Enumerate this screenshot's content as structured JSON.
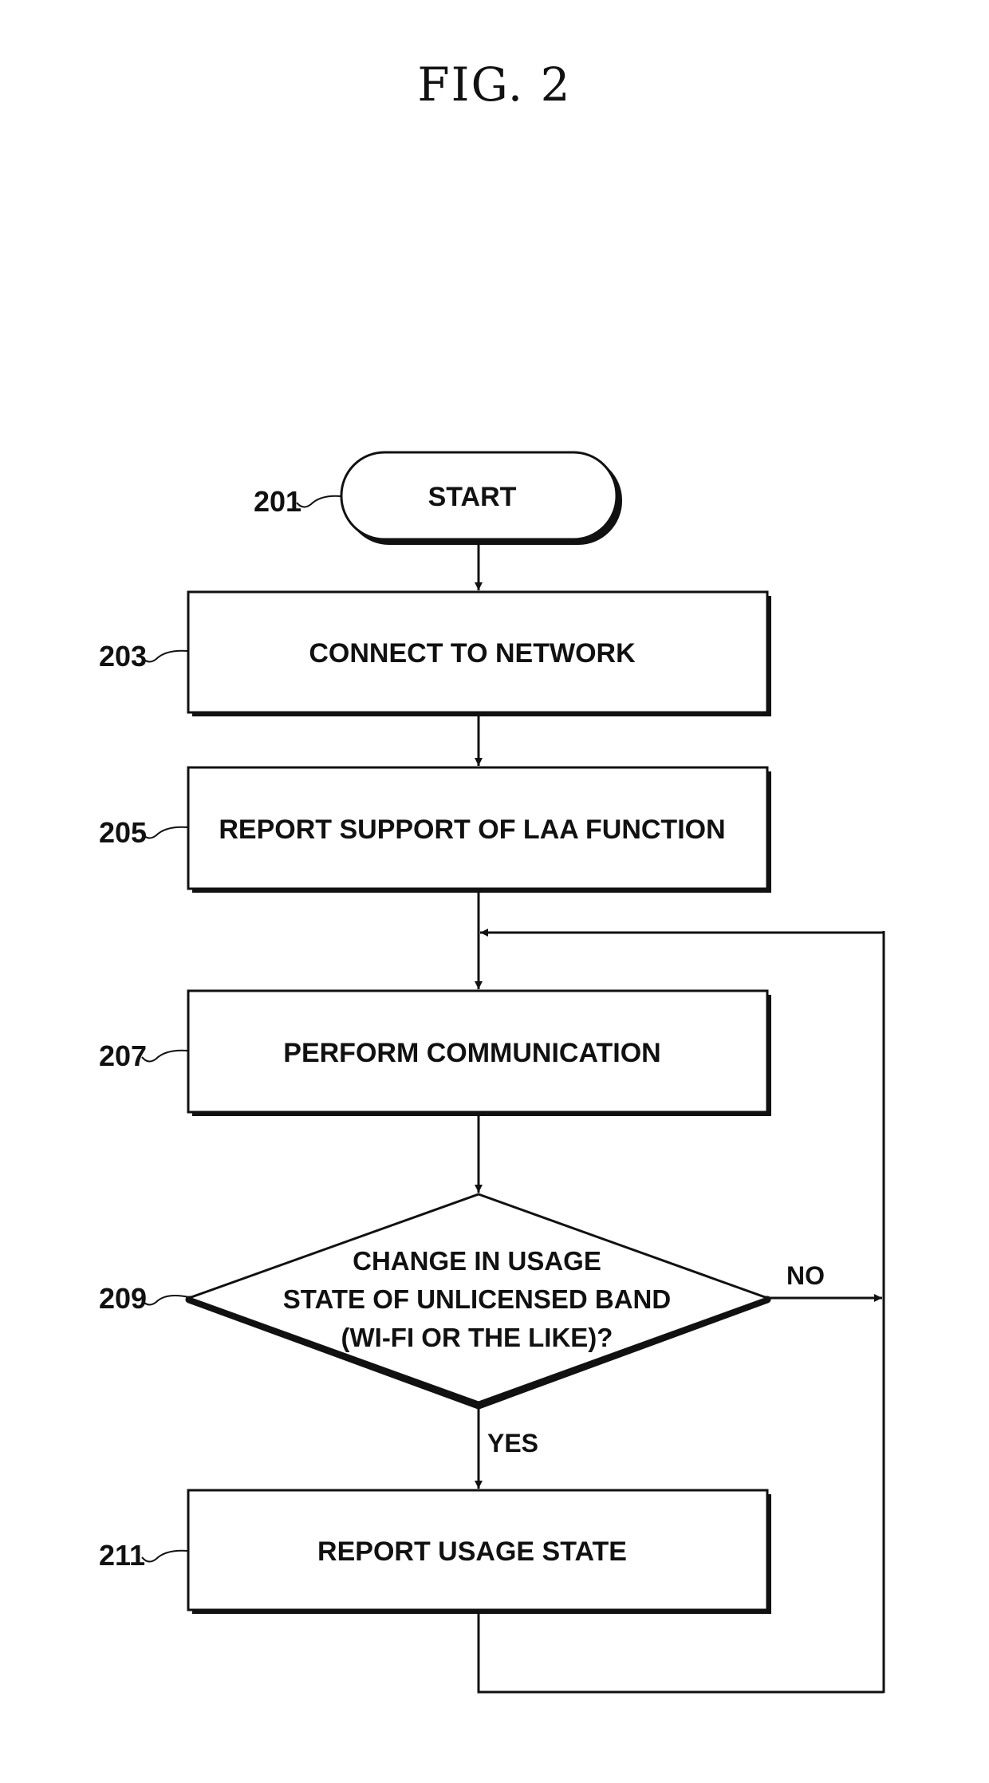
{
  "figure": {
    "title": "FIG. 2"
  },
  "nodes": [
    {
      "id": "201",
      "ref": "201",
      "type": "terminal",
      "lines": [
        "START"
      ]
    },
    {
      "id": "203",
      "ref": "203",
      "type": "process",
      "lines": [
        "CONNECT TO NETWORK"
      ]
    },
    {
      "id": "205",
      "ref": "205",
      "type": "process",
      "lines": [
        "REPORT SUPPORT OF LAA FUNCTION"
      ]
    },
    {
      "id": "207",
      "ref": "207",
      "type": "process",
      "lines": [
        "PERFORM COMMUNICATION"
      ]
    },
    {
      "id": "209",
      "ref": "209",
      "type": "decision",
      "lines": [
        "CHANGE IN USAGE",
        "STATE OF UNLICENSED BAND",
        "(WI-FI OR THE LIKE)?"
      ]
    },
    {
      "id": "211",
      "ref": "211",
      "type": "process",
      "lines": [
        "REPORT USAGE STATE"
      ]
    }
  ],
  "edges": [
    {
      "from": "201",
      "to": "203",
      "label": ""
    },
    {
      "from": "203",
      "to": "205",
      "label": ""
    },
    {
      "from": "205",
      "to": "207",
      "label": ""
    },
    {
      "from": "207",
      "to": "209",
      "label": ""
    },
    {
      "from": "209",
      "to": "211",
      "label": "YES"
    },
    {
      "from": "209",
      "to": "207",
      "label": "NO"
    },
    {
      "from": "211",
      "to": "207",
      "label": ""
    }
  ],
  "branch_labels": {
    "yes": "YES",
    "no": "NO"
  }
}
